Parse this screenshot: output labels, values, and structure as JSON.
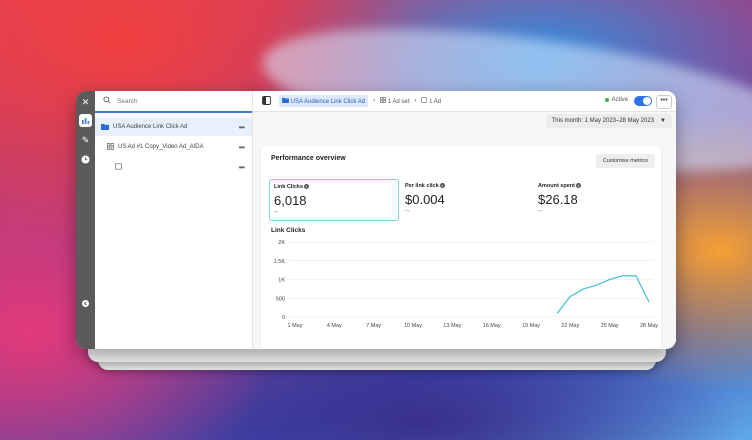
{
  "sidebar": {
    "search_placeholder": "Search",
    "items": [
      {
        "label": "USA Audience Link Click Ad"
      },
      {
        "label": "US Ad #1 Copy_Video Ad_AIDA"
      },
      {
        "label": ""
      }
    ]
  },
  "breadcrumb": {
    "campaign": "USA Audience Link Click Ad",
    "adset": "1 Ad set",
    "ad": "1 Ad"
  },
  "status": {
    "label": "Active",
    "color": "#4caf50"
  },
  "date_range": "This month: 1 May 2023–28 May 2023",
  "overview": {
    "title": "Performance overview",
    "customise_label": "Customise metrics",
    "metrics": [
      {
        "label": "Link Clicks",
        "value": "6,018",
        "compare": "--"
      },
      {
        "label": "Per link click",
        "value": "$0.004",
        "compare": "--"
      },
      {
        "label": "Amount spent",
        "value": "$26.18",
        "compare": "--"
      }
    ]
  },
  "chart_data": {
    "type": "line",
    "title": "Link Clicks",
    "x": [
      "1 May",
      "4 May",
      "7 May",
      "10 May",
      "13 May",
      "16 May",
      "19 May",
      "22 May",
      "25 May",
      "28 May"
    ],
    "y_ticks": [
      "0",
      "500",
      "1K",
      "1.5K",
      "2K"
    ],
    "ylim": [
      0,
      2000
    ],
    "series": [
      {
        "values": [
          {
            "day": 21,
            "y": 100
          },
          {
            "day": 22,
            "y": 550
          },
          {
            "day": 23,
            "y": 750
          },
          {
            "day": 24,
            "y": 850
          },
          {
            "day": 25,
            "y": 1000
          },
          {
            "day": 26,
            "y": 1100
          },
          {
            "day": 27,
            "y": 1100
          },
          {
            "day": 28,
            "y": 400
          }
        ]
      }
    ],
    "line_color": "#4cc3d9",
    "grid": true
  }
}
